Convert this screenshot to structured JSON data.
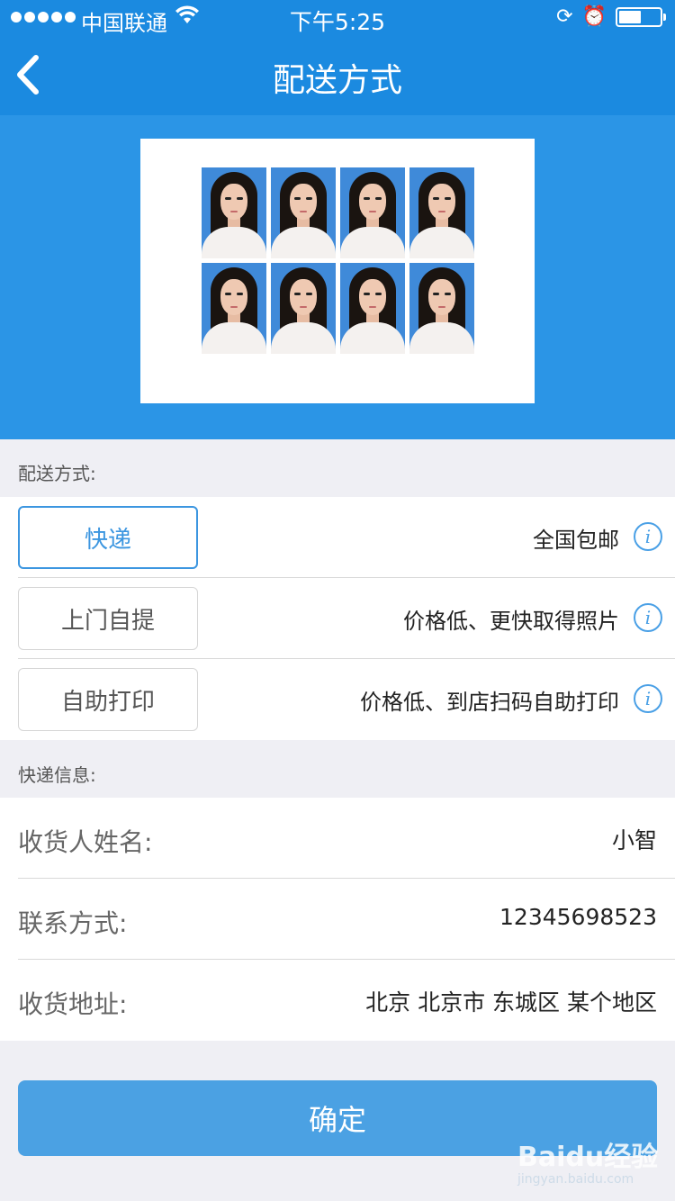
{
  "status_bar": {
    "carrier": "中国联通",
    "time": "下午5:25",
    "battery_level": 0.55
  },
  "nav": {
    "title": "配送方式"
  },
  "preview": {
    "photo_count": 8,
    "photo_background": "#3f8ad9"
  },
  "delivery": {
    "section_label": "配送方式:",
    "options": [
      {
        "label": "快递",
        "desc": "全国包邮",
        "selected": true
      },
      {
        "label": "上门自提",
        "desc": "价格低、更快取得照片",
        "selected": false
      },
      {
        "label": "自助打印",
        "desc": "价格低、到店扫码自助打印",
        "selected": false
      }
    ]
  },
  "express": {
    "section_label": "快递信息:",
    "fields": [
      {
        "label": "收货人姓名:",
        "value": "小智"
      },
      {
        "label": "联系方式:",
        "value": "12345698523"
      },
      {
        "label": "收货地址:",
        "value": "北京 北京市 东城区 某个地区"
      }
    ]
  },
  "confirm_label": "确定",
  "watermark": {
    "brand": "Baidu经验",
    "url": "jingyan.baidu.com"
  },
  "colors": {
    "nav_bg": "#1b8ae0",
    "preview_bg": "#2b95e6",
    "accent": "#3c96e0",
    "button_bg": "#4ba1e3"
  }
}
